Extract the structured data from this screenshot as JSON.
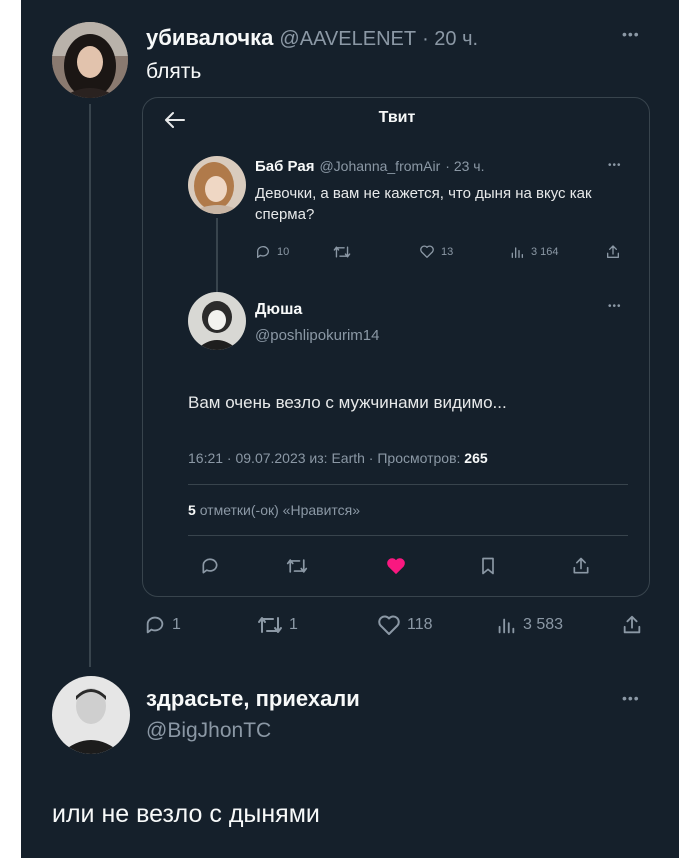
{
  "main_tweet": {
    "display_name": "убивалочка",
    "handle": "@AAVELENET",
    "time": "· 20 ч.",
    "text": "блять",
    "stats": {
      "replies": "1",
      "retweets": "1",
      "likes": "118",
      "views": "3 583"
    }
  },
  "embedded_screen": {
    "title": "Твит",
    "quoted_tweet": {
      "display_name": "Баб Рая",
      "handle": "@Johanna_fromAir",
      "time": "· 23 ч.",
      "text": "Девочки, а вам не кажется, что дыня на вкус как сперма?",
      "stats": {
        "replies": "10",
        "likes": "13",
        "views": "3 164"
      }
    },
    "reply_tweet": {
      "display_name": "Дюша",
      "handle": "@poshlipokurim14",
      "text": "Вам очень везло с мужчинами видимо...",
      "meta_prefix": "16:21 · 09.07.2023 из: Earth · Просмотров:",
      "meta_views": "265",
      "likes_count": "5",
      "likes_label": "отметки(-ок) «Нравится»"
    }
  },
  "reply": {
    "display_name": "здрасьте, приехали",
    "handle": "@BigJhonTC",
    "text": "или не везло с дынями"
  },
  "colors": {
    "background": "#15202b",
    "text": "#e7e9ea",
    "muted": "#8b98a5",
    "border": "#38444d",
    "like": "#f91880"
  }
}
